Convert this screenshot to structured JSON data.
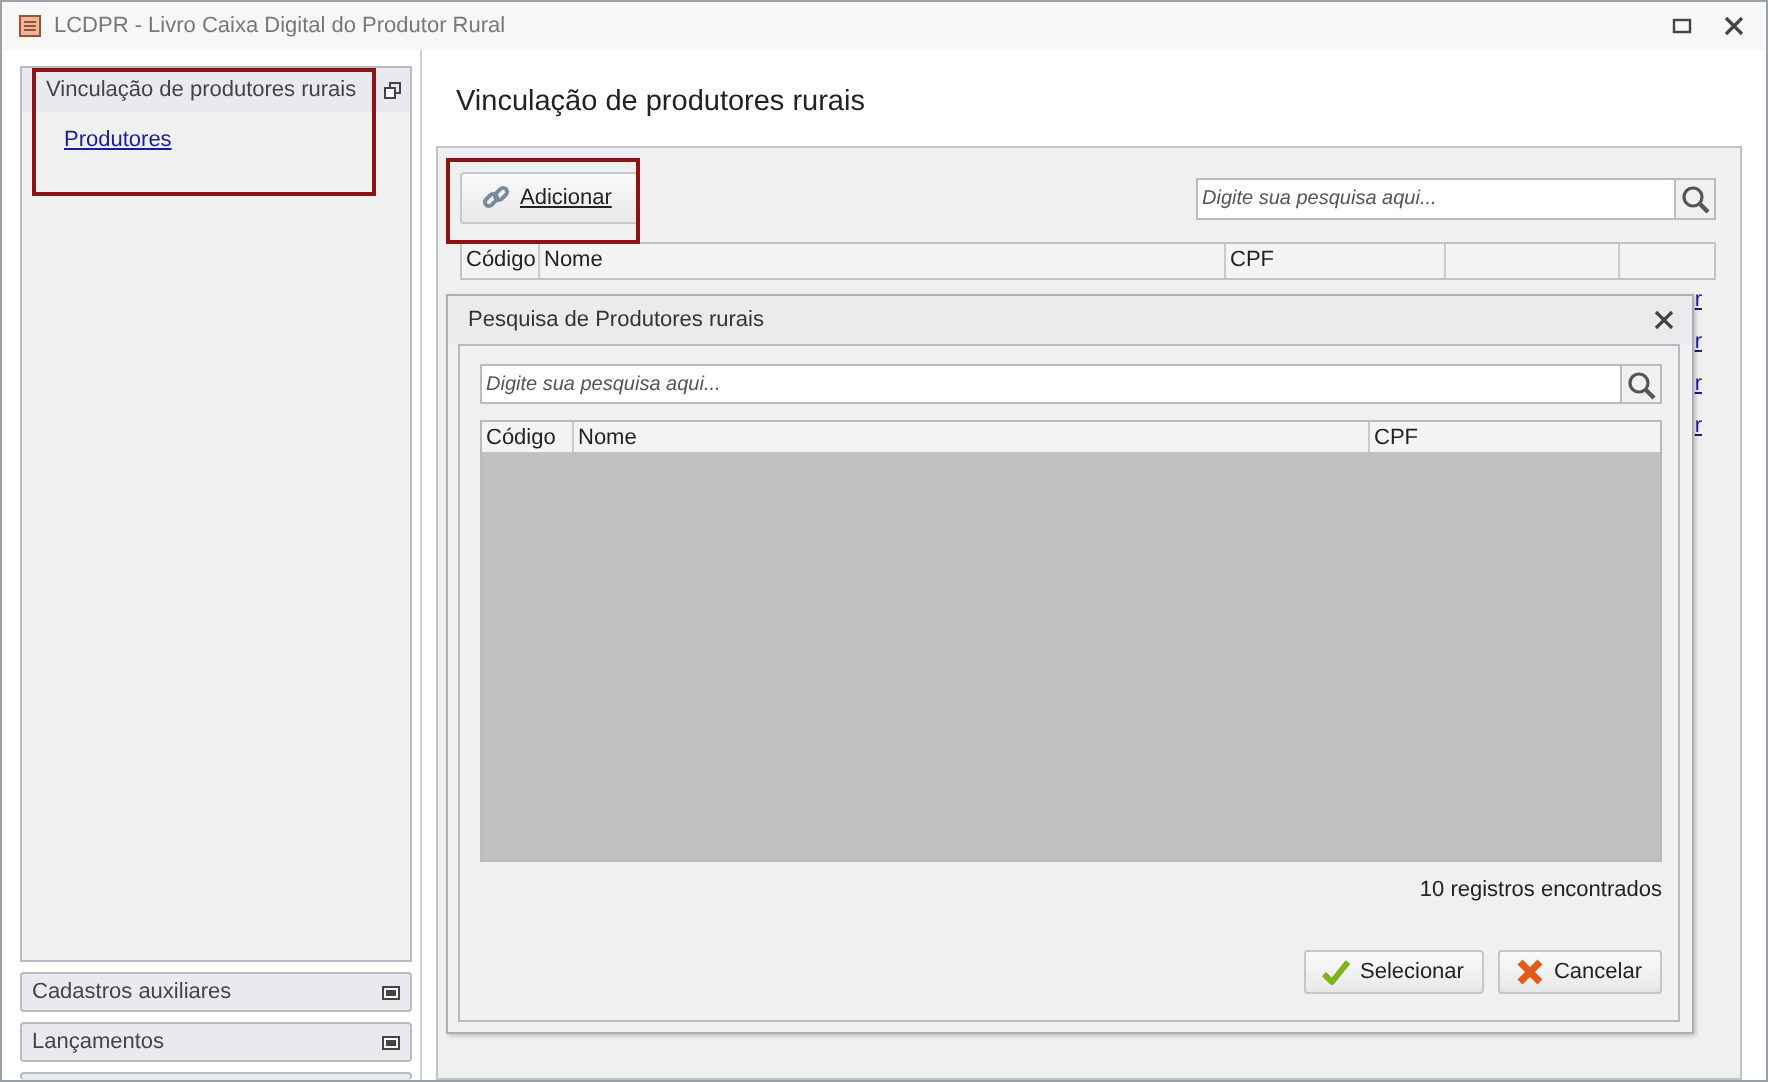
{
  "window": {
    "title": "LCDPR - Livro Caixa Digital do Produtor Rural"
  },
  "sidebar": {
    "panels": [
      {
        "title": "Vinculação de produtores rurais",
        "expanded": true,
        "items": [
          {
            "label": "Produtores"
          }
        ]
      },
      {
        "title": "Cadastros auxiliares",
        "expanded": false
      },
      {
        "title": "Lançamentos",
        "expanded": false
      }
    ]
  },
  "page": {
    "heading": "Vinculação de produtores rurais",
    "add_button": "Adicionar",
    "search": {
      "placeholder": "Digite sua pesquisa aqui..."
    },
    "table": {
      "columns": [
        "Código",
        "Nome",
        "CPF",
        "",
        ""
      ],
      "row_links": [
        "r",
        "r",
        "r",
        "r"
      ]
    }
  },
  "dialog": {
    "title": "Pesquisa de Produtores rurais",
    "search": {
      "placeholder": "Digite sua pesquisa aqui..."
    },
    "columns": [
      "Código",
      "Nome",
      "CPF"
    ],
    "count": "10 registros encontrados",
    "buttons": [
      {
        "kind": "confirm",
        "label": "Selecionar"
      },
      {
        "kind": "cancel",
        "label": "Cancelar"
      }
    ]
  }
}
